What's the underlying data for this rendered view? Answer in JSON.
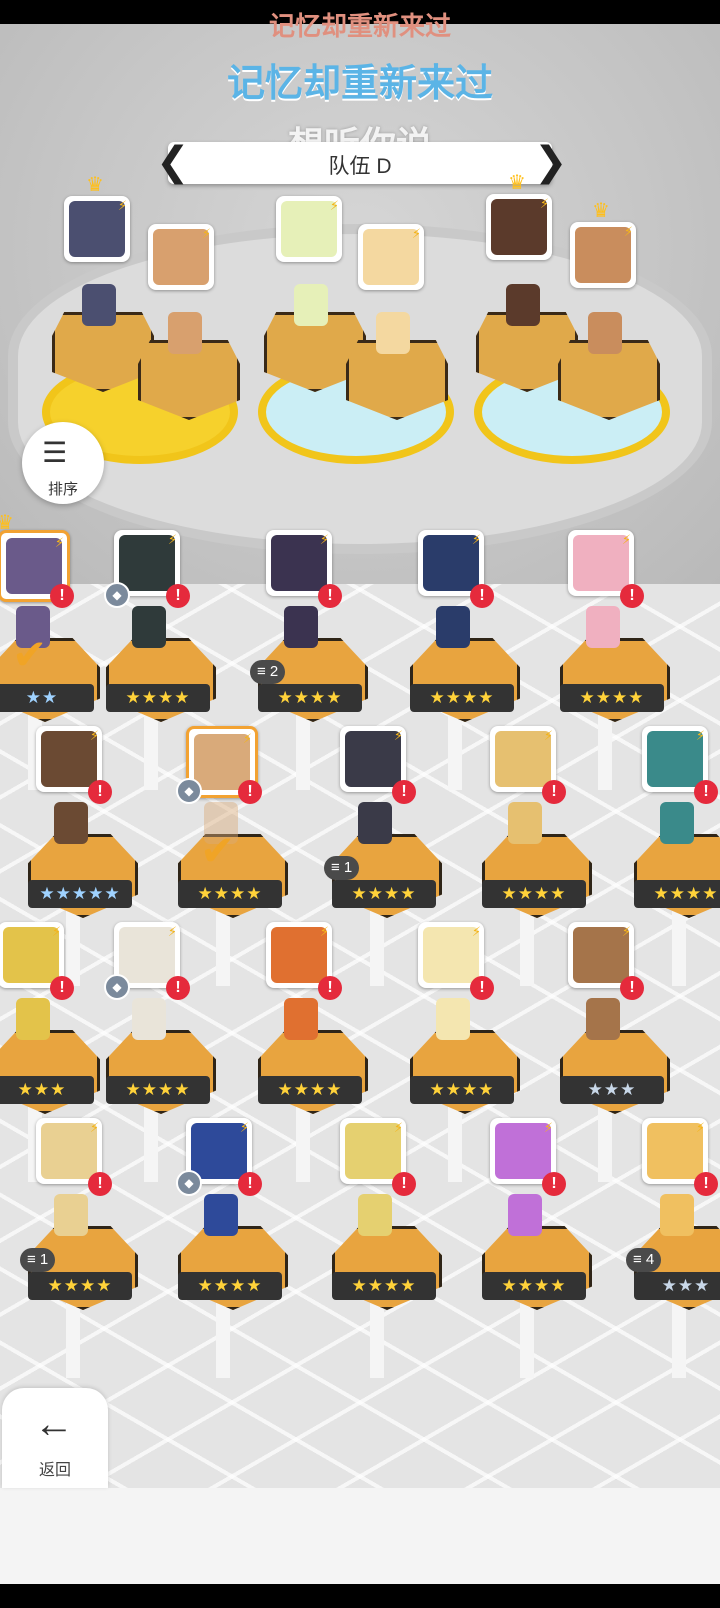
{
  "ticker": {
    "line1": "记忆却重新来过",
    "line2": "记忆却重新来过",
    "line3": "想听你说"
  },
  "team_selector": {
    "name": "队伍 D",
    "prev_icon": "chevron-left-icon",
    "next_icon": "chevron-right-icon"
  },
  "sort_button": {
    "label": "排序",
    "icon": "sort-icon"
  },
  "back_button": {
    "label": "返回",
    "icon": "arrow-left-icon"
  },
  "team_slots": [
    {
      "color": "#4b4f70",
      "crown": true
    },
    {
      "color": "#d8a06e",
      "crown": false
    },
    {
      "color": "#e6f0b8",
      "crown": false
    },
    {
      "color": "#f4d8a0",
      "crown": false
    },
    {
      "color": "#5b3a2b",
      "crown": true
    },
    {
      "color": "#c98d5d",
      "crown": true
    }
  ],
  "roster": [
    {
      "row": 0,
      "portrait_color": "#6a5a8a",
      "alert": true,
      "shield": false,
      "stack": "",
      "stars": "★★",
      "star_type": "rainbow",
      "selected": true,
      "crown": true
    },
    {
      "row": 0,
      "portrait_color": "#2f3a3a",
      "alert": true,
      "shield": true,
      "stack": "",
      "stars": "★★★★",
      "star_type": "gold",
      "selected": false
    },
    {
      "row": 0,
      "portrait_color": "#3b3350",
      "alert": true,
      "shield": false,
      "stack": "2",
      "stars": "★★★★",
      "star_type": "gold",
      "selected": false
    },
    {
      "row": 0,
      "portrait_color": "#2a3c6a",
      "alert": true,
      "shield": false,
      "stack": "",
      "stars": "★★★★",
      "star_type": "gold",
      "selected": false
    },
    {
      "row": 0,
      "portrait_color": "#f0b0c0",
      "alert": true,
      "shield": false,
      "stack": "",
      "stars": "★★★★",
      "star_type": "gold",
      "selected": false
    },
    {
      "row": 1,
      "portrait_color": "#6b4a33",
      "alert": true,
      "shield": false,
      "stack": "",
      "stars": "★★★★★",
      "star_type": "rainbow",
      "selected": false
    },
    {
      "row": 1,
      "portrait_color": "#d9aa7a",
      "alert": true,
      "shield": true,
      "stack": "",
      "stars": "★★★★",
      "star_type": "gold",
      "selected": true
    },
    {
      "row": 1,
      "portrait_color": "#3a3a48",
      "alert": true,
      "shield": false,
      "stack": "1",
      "stars": "★★★★",
      "star_type": "gold",
      "selected": false
    },
    {
      "row": 1,
      "portrait_color": "#e6c070",
      "alert": true,
      "shield": false,
      "stack": "",
      "stars": "★★★★",
      "star_type": "gold",
      "selected": false
    },
    {
      "row": 1,
      "portrait_color": "#3a8a8a",
      "alert": true,
      "shield": false,
      "stack": "",
      "stars": "★★★★",
      "star_type": "gold",
      "selected": false
    },
    {
      "row": 2,
      "portrait_color": "#e3c34a",
      "alert": true,
      "shield": false,
      "stack": "",
      "stars": "★★★",
      "star_type": "gold",
      "selected": false
    },
    {
      "row": 2,
      "portrait_color": "#e9e4d9",
      "alert": true,
      "shield": true,
      "stack": "",
      "stars": "★★★★",
      "star_type": "gold",
      "selected": false
    },
    {
      "row": 2,
      "portrait_color": "#e07030",
      "alert": true,
      "shield": false,
      "stack": "",
      "stars": "★★★★",
      "star_type": "gold",
      "selected": false
    },
    {
      "row": 2,
      "portrait_color": "#f4e6b0",
      "alert": true,
      "shield": false,
      "stack": "",
      "stars": "★★★★",
      "star_type": "gold",
      "selected": false
    },
    {
      "row": 2,
      "portrait_color": "#a5744a",
      "alert": true,
      "shield": false,
      "stack": "",
      "stars": "★★★",
      "star_type": "silver",
      "selected": false
    },
    {
      "row": 3,
      "portrait_color": "#e9d092",
      "alert": true,
      "shield": false,
      "stack": "1",
      "stars": "★★★★",
      "star_type": "gold",
      "selected": false
    },
    {
      "row": 3,
      "portrait_color": "#2e4a9a",
      "alert": true,
      "shield": true,
      "stack": "",
      "stars": "★★★★",
      "star_type": "gold",
      "selected": false
    },
    {
      "row": 3,
      "portrait_color": "#e5d070",
      "alert": true,
      "shield": false,
      "stack": "",
      "stars": "★★★★",
      "star_type": "gold",
      "selected": false
    },
    {
      "row": 3,
      "portrait_color": "#c070d8",
      "alert": true,
      "shield": false,
      "stack": "",
      "stars": "★★★★",
      "star_type": "gold",
      "selected": false
    },
    {
      "row": 3,
      "portrait_color": "#f0c060",
      "alert": true,
      "shield": false,
      "stack": "4",
      "stars": "★★★",
      "star_type": "silver",
      "selected": false
    }
  ]
}
